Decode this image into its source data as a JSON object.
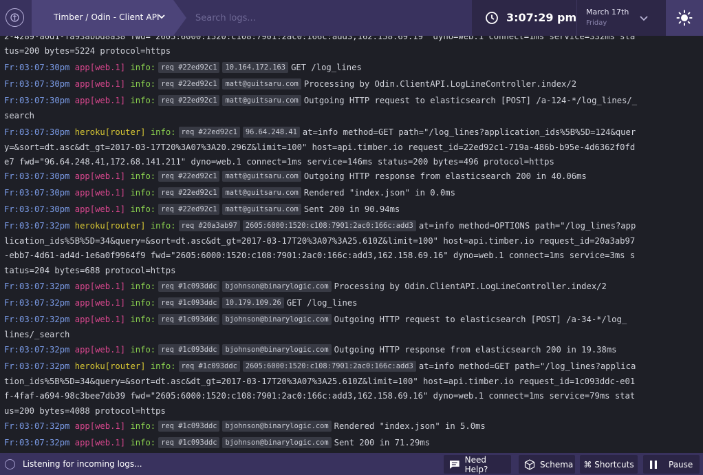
{
  "header": {
    "app_title": "Timber / Odin - Client API",
    "search_placeholder": "Search logs...",
    "time": "3:07:29 pm",
    "date": "March 17th",
    "day": "Friday"
  },
  "log_fragment": "2-4289-a0d1-fa93abbd8a38 fwd=\"2605:6000:1520:c108:7901:2ac0:166c:add3,162.158.69.19\" dyno=web.1 connect=1ms service=332ms sta",
  "log_fragment_cont": "tus=200 bytes=5224 protocol=https",
  "logs": [
    {
      "ts": "Fr:03:07:30pm",
      "src": "app[web.1]",
      "lvl": "info:",
      "req": "req #22ed92c1",
      "tag": "10.164.172.163",
      "msg": "GET /log_lines",
      "cont": ""
    },
    {
      "ts": "Fr:03:07:30pm",
      "src": "app[web.1]",
      "lvl": "info:",
      "req": "req #22ed92c1",
      "tag": "matt@guitsaru.com",
      "msg": "Processing by Odin.ClientAPI.LogLineController.index/2",
      "cont": ""
    },
    {
      "ts": "Fr:03:07:30pm",
      "src": "app[web.1]",
      "lvl": "info:",
      "req": "req #22ed92c1",
      "tag": "matt@guitsaru.com",
      "msg": "Outgoing HTTP request to elasticsearch [POST] /a-124-*/log_lines/_",
      "cont": "search"
    },
    {
      "ts": "Fr:03:07:30pm",
      "src": "heroku[router]",
      "lvl": "info:",
      "req": "req #22ed92c1",
      "tag": "96.64.248.41",
      "msg": "at=info method=GET path=\"/log_lines?application_ids%5B%5D=124&quer",
      "cont": "y=&sort=dt.asc&dt_gt=2017-03-17T20%3A07%3A20.296Z&limit=100\" host=api.timber.io request_id=22ed92c1-719a-486b-b95e-4d6362f0fd\ne7 fwd=\"96.64.248.41,172.68.141.211\" dyno=web.1 connect=1ms service=146ms status=200 bytes=496 protocol=https"
    },
    {
      "ts": "Fr:03:07:30pm",
      "src": "app[web.1]",
      "lvl": "info:",
      "req": "req #22ed92c1",
      "tag": "matt@guitsaru.com",
      "msg": "Outgoing HTTP response from elasticsearch 200 in 40.06ms",
      "cont": ""
    },
    {
      "ts": "Fr:03:07:30pm",
      "src": "app[web.1]",
      "lvl": "info:",
      "req": "req #22ed92c1",
      "tag": "matt@guitsaru.com",
      "msg": "Rendered \"index.json\" in 0.0ms",
      "cont": ""
    },
    {
      "ts": "Fr:03:07:30pm",
      "src": "app[web.1]",
      "lvl": "info:",
      "req": "req #22ed92c1",
      "tag": "matt@guitsaru.com",
      "msg": "Sent 200 in 90.94ms",
      "cont": ""
    },
    {
      "ts": "Fr:03:07:32pm",
      "src": "heroku[router]",
      "lvl": "info:",
      "req": "req #20a3ab97",
      "tag": "2605:6000:1520:c108:7901:2ac0:166c:add3",
      "msg": "at=info method=OPTIONS path=\"/log_lines?app",
      "cont": "lication_ids%5B%5D=34&query=&sort=dt.asc&dt_gt=2017-03-17T20%3A07%3A25.610Z&limit=100\" host=api.timber.io request_id=20a3ab97\n-ebb7-4d61-ad4d-1e6a0f9964f9 fwd=\"2605:6000:1520:c108:7901:2ac0:166c:add3,162.158.69.16\" dyno=web.1 connect=1ms service=3ms s\ntatus=204 bytes=688 protocol=https"
    },
    {
      "ts": "Fr:03:07:32pm",
      "src": "app[web.1]",
      "lvl": "info:",
      "req": "req #1c093ddc",
      "tag": "bjohnson@binarylogic.com",
      "msg": "Processing by Odin.ClientAPI.LogLineController.index/2",
      "cont": ""
    },
    {
      "ts": "Fr:03:07:32pm",
      "src": "app[web.1]",
      "lvl": "info:",
      "req": "req #1c093ddc",
      "tag": "10.179.109.26",
      "msg": "GET /log_lines",
      "cont": ""
    },
    {
      "ts": "Fr:03:07:32pm",
      "src": "app[web.1]",
      "lvl": "info:",
      "req": "req #1c093ddc",
      "tag": "bjohnson@binarylogic.com",
      "msg": "Outgoing HTTP request to elasticsearch [POST] /a-34-*/log_",
      "cont": "lines/_search"
    },
    {
      "ts": "Fr:03:07:32pm",
      "src": "app[web.1]",
      "lvl": "info:",
      "req": "req #1c093ddc",
      "tag": "bjohnson@binarylogic.com",
      "msg": "Outgoing HTTP response from elasticsearch 200 in 19.38ms",
      "cont": ""
    },
    {
      "ts": "Fr:03:07:32pm",
      "src": "heroku[router]",
      "lvl": "info:",
      "req": "req #1c093ddc",
      "tag": "2605:6000:1520:c108:7901:2ac0:166c:add3",
      "msg": "at=info method=GET path=\"/log_lines?applica",
      "cont": "tion_ids%5B%5D=34&query=&sort=dt.asc&dt_gt=2017-03-17T20%3A07%3A25.610Z&limit=100\" host=api.timber.io request_id=1c093ddc-e01\nf-4faf-a694-98c3bee7db39 fwd=\"2605:6000:1520:c108:7901:2ac0:166c:add3,162.158.69.16\" dyno=web.1 connect=1ms service=79ms stat\nus=200 bytes=4088 protocol=https"
    },
    {
      "ts": "Fr:03:07:32pm",
      "src": "app[web.1]",
      "lvl": "info:",
      "req": "req #1c093ddc",
      "tag": "bjohnson@binarylogic.com",
      "msg": "Rendered \"index.json\" in 5.0ms",
      "cont": ""
    },
    {
      "ts": "Fr:03:07:32pm",
      "src": "app[web.1]",
      "lvl": "info:",
      "req": "req #1c093ddc",
      "tag": "bjohnson@binarylogic.com",
      "msg": "Sent 200 in 71.29ms",
      "cont": ""
    }
  ],
  "footer": {
    "status": "Listening for incoming logs...",
    "help_label": "Need Help?",
    "schema_label": "Schema",
    "shortcuts_label": "⌘ Shortcuts",
    "pause_label": "Pause"
  },
  "colors": {
    "header_bg": "#39325e",
    "log_bg": "#1e1f26",
    "timestamp": "#7b9ce8",
    "app_source": "#d9478e",
    "router_source": "#d6c634",
    "level_info": "#8bd24f"
  }
}
